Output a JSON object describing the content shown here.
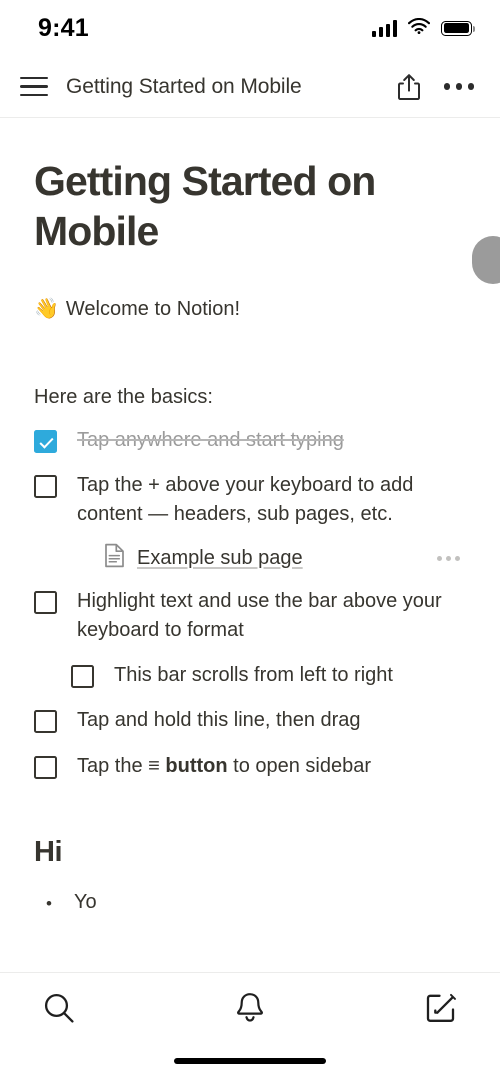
{
  "status_bar": {
    "time": "9:41",
    "signal_icon": "cellular-signal-icon",
    "wifi_icon": "wifi-icon",
    "battery_icon": "battery-full-icon"
  },
  "app_bar": {
    "menu_icon": "hamburger-menu-icon",
    "title": "Getting Started on Mobile",
    "share_icon": "share-icon",
    "more_icon": "more-options-icon"
  },
  "page": {
    "title": "Getting Started on Mobile",
    "welcome": {
      "emoji": "👋",
      "text": "Welcome to Notion!"
    },
    "basics_label": "Here are the basics:",
    "todos": [
      {
        "text": "Tap anywhere and start typing",
        "checked": true
      },
      {
        "text": "Tap the + above your keyboard to add content — headers, sub pages, etc.",
        "checked": false
      },
      {
        "text": "Highlight text and use the bar above your keyboard to format",
        "checked": false
      },
      {
        "text": "This bar scrolls from left to right",
        "checked": false,
        "nested": true
      },
      {
        "text": "Tap and hold this line, then drag",
        "checked": false
      }
    ],
    "sidebar_todo": {
      "prefix": "Tap the ≡ ",
      "bold": "button",
      "suffix": " to open sidebar",
      "checked": false
    },
    "sub_page": {
      "icon": "page-document-icon",
      "name": "Example sub page",
      "menu_icon": "more-options-icon"
    },
    "heading_hi": "Hi",
    "bullet_item": "Yo",
    "bullet_glyph": "•"
  },
  "bottom_bar": {
    "search_icon": "search-icon",
    "notifications_icon": "bell-icon",
    "compose_icon": "compose-edit-icon"
  },
  "colors": {
    "checked_checkbox": "#2eaadc",
    "text": "#37352f",
    "muted_text": "#9b9b9b",
    "divider": "#ececeb"
  }
}
